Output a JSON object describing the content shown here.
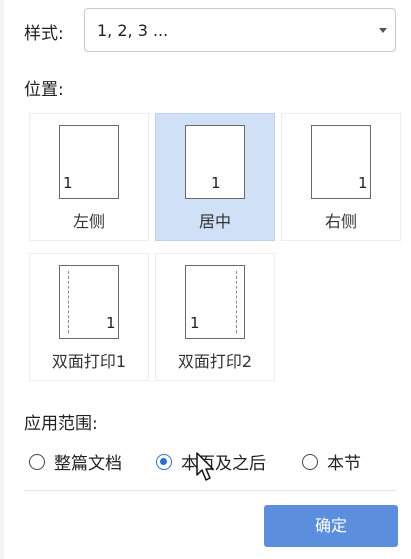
{
  "style": {
    "label": "样式:",
    "value": "1, 2, 3 ..."
  },
  "position": {
    "label": "位置:",
    "options": [
      {
        "caption": "左侧",
        "number": "1",
        "selected": false
      },
      {
        "caption": "居中",
        "number": "1",
        "selected": true
      },
      {
        "caption": "右侧",
        "number": "1",
        "selected": false
      },
      {
        "caption": "双面打印1",
        "number": "1",
        "selected": false
      },
      {
        "caption": "双面打印2",
        "number": "1",
        "selected": false
      }
    ]
  },
  "scope": {
    "label": "应用范围:",
    "options": [
      {
        "label": "整篇文档",
        "checked": false
      },
      {
        "label": "本页及之后",
        "checked": true
      },
      {
        "label": "本节",
        "checked": false
      }
    ]
  },
  "buttons": {
    "ok": "确定"
  },
  "colors": {
    "accent": "#5b8fde",
    "selected_bg": "#cfe0f7"
  }
}
